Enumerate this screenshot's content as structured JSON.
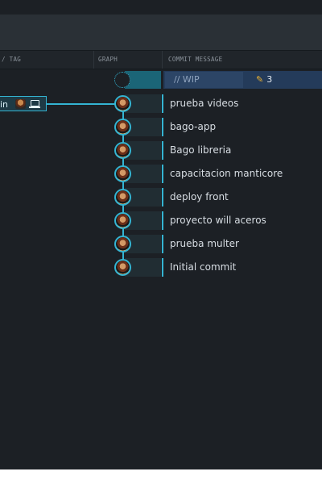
{
  "columns": {
    "branch_tag": "/ TAG",
    "graph": "GRAPH",
    "commit_message": "COMMIT MESSAGE"
  },
  "wip": {
    "placeholder": "// WIP",
    "changed_files_count": "3"
  },
  "branch": {
    "label": "in",
    "icons": [
      "avatar-icon",
      "computer-icon"
    ]
  },
  "commits": [
    {
      "message": "prueba videos"
    },
    {
      "message": "bago-app"
    },
    {
      "message": "Bago libreria"
    },
    {
      "message": "capacitacion manticore"
    },
    {
      "message": "deploy front"
    },
    {
      "message": "proyecto will aceros"
    },
    {
      "message": "prueba multer"
    },
    {
      "message": "Initial commit"
    }
  ],
  "colors": {
    "accent": "#34b4d2",
    "wip_highlight": "#243b5a",
    "pencil": "#f0b531",
    "background": "#1c2025"
  }
}
